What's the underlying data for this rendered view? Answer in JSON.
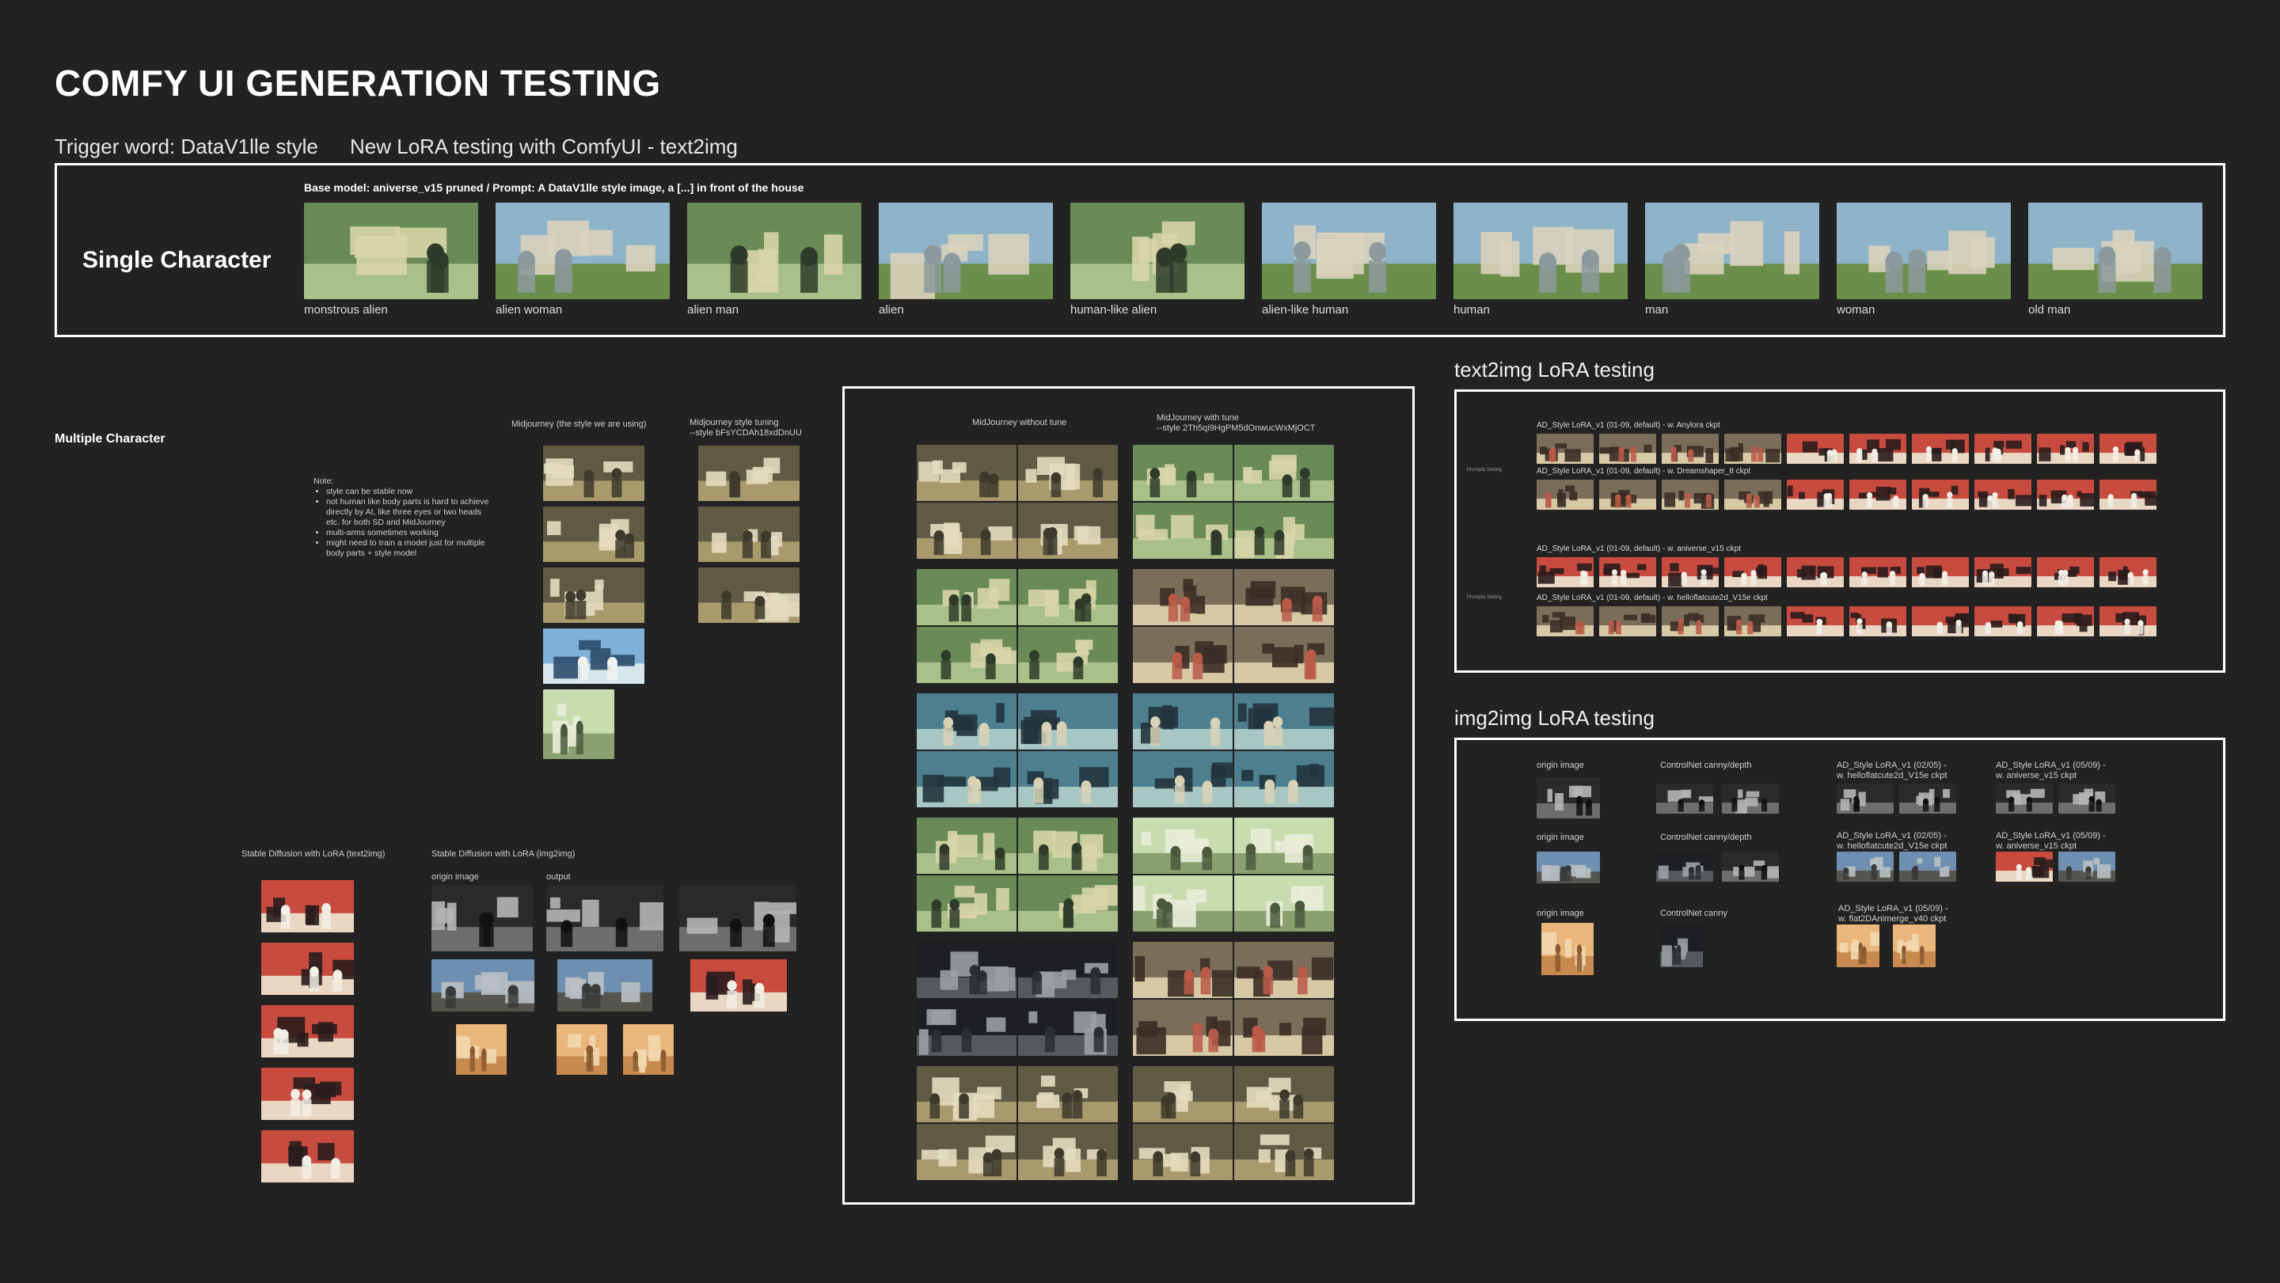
{
  "header": {
    "title": "COMFY UI GENERATION TESTING",
    "trigger": "Trigger word: DataV1lle style",
    "subtitle": "New LoRA testing with ComfyUI - text2img"
  },
  "single": {
    "heading": "Single Character",
    "caption": "Base model: aniverse_v15 pruned / Prompt: A DataV1lle style image, a [...] in front of the house",
    "items": [
      "monstrous alien",
      "alien woman",
      "alien man",
      "alien",
      "human-like alien",
      "alien-like human",
      "human",
      "man",
      "woman",
      "old man"
    ]
  },
  "multi": {
    "heading": "Multiple Character",
    "note_title": "Note:",
    "notes": [
      "style can be stable now",
      "not human like body parts is hard to achieve directly by AI, like three eyes or two heads etc. for both SD and MidJourney",
      "multi-arms sometimes working",
      "might need to train a model just for multiple body parts + style model"
    ],
    "mj_label": "Midjourney (the style we are using)",
    "mj_tune_label": "Midjourney style tuning\n--style bFsYCDAh18xdDnUU"
  },
  "sd": {
    "t2i_label": "Stable Diffusion with LoRA (text2img)",
    "i2i_label": "Stable Diffusion with LoRA (img2img)",
    "origin": "origin image",
    "output": "output"
  },
  "compare": {
    "without": "MidJourney without tune",
    "with": "MidJourney with tune\n--style 2Th5qi9HgPM5dOnwucWxMjOCT"
  },
  "t2i": {
    "heading": "text2img LoRA testing",
    "rows": [
      "AD_Style LoRA_v1 (01-09, default) - w. Anylora ckpt",
      "AD_Style LoRA_v1 (01-09, default) - w. Dreamshaper_8 ckpt",
      "AD_Style LoRA_v1 (01-09, default) - w. aniverse_v15 ckpt",
      "AD_Style LoRA_v1 (01-09, default) - w. helloflatcute2d_V15e ckpt"
    ],
    "prompt_label": "Prompt& Setting"
  },
  "i2i": {
    "heading": "img2img LoRA testing",
    "origin": "origin image",
    "cn_cd": "ControlNet canny/depth",
    "cn_c": "ControlNet canny",
    "r1a": "AD_Style LoRA_v1 (02/05) -\nw. helloflatcute2d_V15e ckpt",
    "r1b": "AD_Style LoRA_v1 (05/09) -\nw. aniverse_v15 ckpt",
    "r3a": "AD_Style LoRA_v1 (05/09) -\nw. flat2DAnimerge_v40 ckpt"
  }
}
